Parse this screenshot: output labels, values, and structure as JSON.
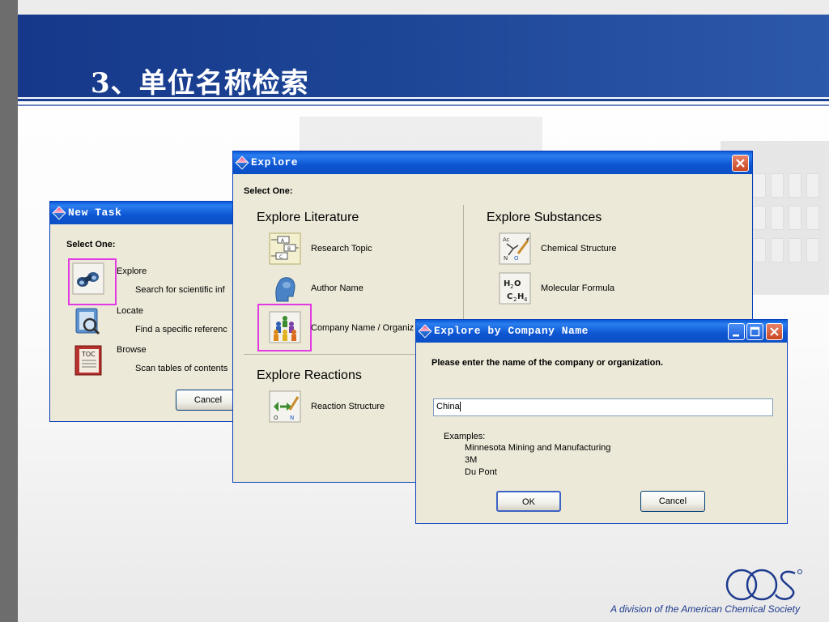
{
  "slide": {
    "title": "3、单位名称检索",
    "footer": "A division of the American Chemical Society",
    "logo_text": "cas"
  },
  "new_task": {
    "title": "New Task",
    "select_label": "Select One:",
    "items": [
      {
        "label": "Explore",
        "desc": "Search for scientific inf"
      },
      {
        "label": "Locate",
        "desc": "Find a specific referenc"
      },
      {
        "label": "Browse",
        "desc": "Scan tables of contents"
      }
    ],
    "cancel_label": "Cancel"
  },
  "explore": {
    "title": "Explore",
    "select_label": "Select One:",
    "literature": {
      "heading": "Explore Literature",
      "items": [
        {
          "label": "Research Topic"
        },
        {
          "label": "Author Name"
        },
        {
          "label": "Company Name / Organiz"
        }
      ]
    },
    "substances": {
      "heading": "Explore Substances",
      "items": [
        {
          "label": "Chemical Structure"
        },
        {
          "label": "Molecular Formula"
        }
      ]
    },
    "reactions": {
      "heading": "Explore Reactions",
      "items": [
        {
          "label": "Reaction Structure"
        }
      ]
    }
  },
  "company_dialog": {
    "title": "Explore by Company Name",
    "prompt": "Please enter the name of the company or organization.",
    "input_value": "China",
    "examples_label": "Examples:",
    "examples": [
      "Minnesota Mining and Manufacturing",
      "3M",
      "Du Pont"
    ],
    "ok_label": "OK",
    "cancel_label": "Cancel"
  },
  "colors": {
    "header_blue": "#1d4596",
    "titlebar_blue": "#0b55d2",
    "dialog_face": "#ece9d8",
    "highlight": "#e23ae2"
  }
}
